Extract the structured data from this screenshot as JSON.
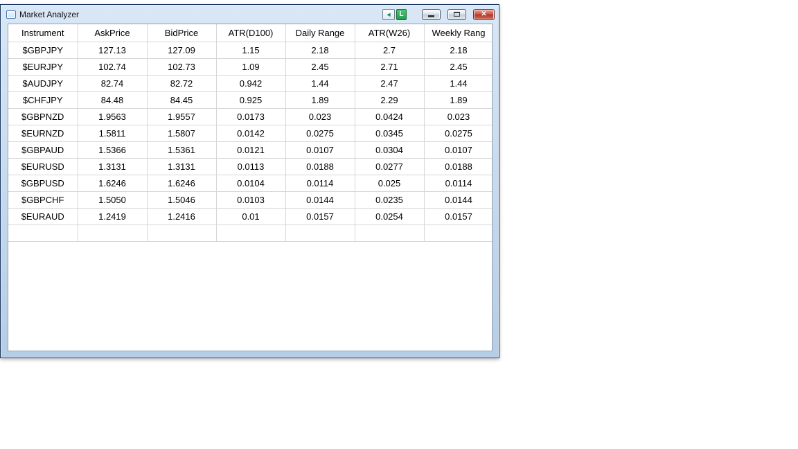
{
  "window": {
    "title": "Market Analyzer",
    "controls": {
      "link_arrow_glyph": "◄",
      "link_button_label": "L",
      "close_glyph": "✕"
    },
    "colors": {
      "titlebar_top": "#d9e7f6",
      "titlebar_bottom": "#b6cde6",
      "link_button_green": "#4fc477",
      "close_red": "#cf5949"
    }
  },
  "table": {
    "columns": [
      "Instrument",
      "AskPrice",
      "BidPrice",
      "ATR(D100)",
      "Daily Range",
      "ATR(W26)",
      "Weekly Rang"
    ],
    "rows": [
      [
        "$GBPJPY",
        "127.13",
        "127.09",
        "1.15",
        "2.18",
        "2.7",
        "2.18"
      ],
      [
        "$EURJPY",
        "102.74",
        "102.73",
        "1.09",
        "2.45",
        "2.71",
        "2.45"
      ],
      [
        "$AUDJPY",
        "82.74",
        "82.72",
        "0.942",
        "1.44",
        "2.47",
        "1.44"
      ],
      [
        "$CHFJPY",
        "84.48",
        "84.45",
        "0.925",
        "1.89",
        "2.29",
        "1.89"
      ],
      [
        "$GBPNZD",
        "1.9563",
        "1.9557",
        "0.0173",
        "0.023",
        "0.0424",
        "0.023"
      ],
      [
        "$EURNZD",
        "1.5811",
        "1.5807",
        "0.0142",
        "0.0275",
        "0.0345",
        "0.0275"
      ],
      [
        "$GBPAUD",
        "1.5366",
        "1.5361",
        "0.0121",
        "0.0107",
        "0.0304",
        "0.0107"
      ],
      [
        "$EURUSD",
        "1.3131",
        "1.3131",
        "0.0113",
        "0.0188",
        "0.0277",
        "0.0188"
      ],
      [
        "$GBPUSD",
        "1.6246",
        "1.6246",
        "0.0104",
        "0.0114",
        "0.025",
        "0.0114"
      ],
      [
        "$GBPCHF",
        "1.5050",
        "1.5046",
        "0.0103",
        "0.0144",
        "0.0235",
        "0.0144"
      ],
      [
        "$EURAUD",
        "1.2419",
        "1.2416",
        "0.01",
        "0.0157",
        "0.0254",
        "0.0157"
      ],
      [
        "",
        "",
        "",
        "",
        "",
        "",
        ""
      ]
    ]
  }
}
